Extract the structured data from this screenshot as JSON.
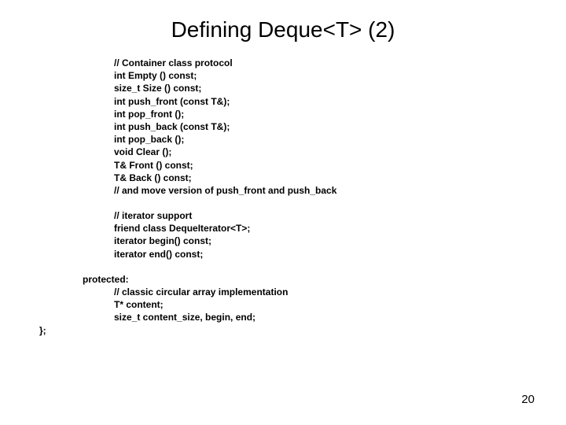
{
  "title": "Defining Deque<T> (2)",
  "block1": {
    "comment": "// Container class protocol",
    "lines": [
      "int Empty () const;",
      "size_t Size () const;",
      "int push_front (const T&);",
      "int pop_front ();",
      "int push_back (const T&);",
      "int pop_back ();",
      "void Clear ();",
      "T& Front () const;",
      "T& Back () const;",
      "// and move version of push_front and push_back"
    ]
  },
  "block2": {
    "comment": "// iterator support",
    "lines": [
      "friend class DequeIterator<T>;",
      "iterator begin() const;",
      "iterator end() const;"
    ]
  },
  "protected_label": "protected:",
  "block3": {
    "comment": "// classic circular array implementation",
    "lines": [
      "T* content;",
      "size_t content_size, begin, end;"
    ]
  },
  "closing": "};",
  "page_number": "20"
}
